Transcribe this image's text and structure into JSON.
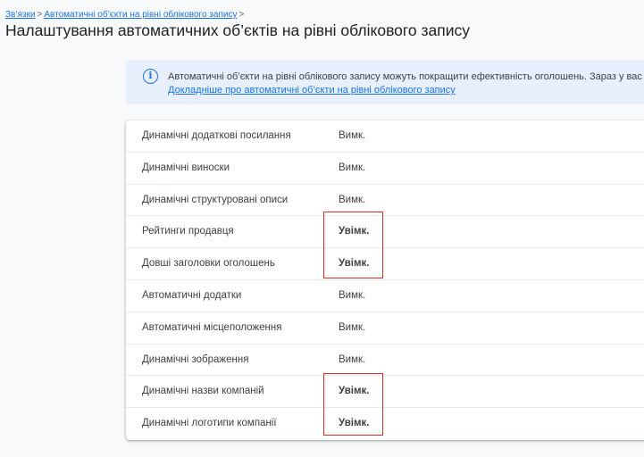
{
  "breadcrumb": {
    "items": [
      "Зв’язки",
      "Автоматичні об’єкти на рівні облікового запису"
    ],
    "separator": ">"
  },
  "page_title": "Налаштування автоматичних об’єктів на рівні облікового запису",
  "info_banner": {
    "icon": "info-icon",
    "text": "Автоматичні об’єкти на рівні облікового запису можуть покращити ефективність оголошень. Зараз у вас",
    "link": "Докладніше про автоматичні об’єкти на рівні облікового запису"
  },
  "settings": [
    {
      "label": "Динамічні додаткові посилання",
      "status": "Вимк."
    },
    {
      "label": "Динамічні виноски",
      "status": "Вимк."
    },
    {
      "label": "Динамічні структуровані описи",
      "status": "Вимк."
    },
    {
      "label": "Рейтинги продавця",
      "status": "Увімк."
    },
    {
      "label": "Довші заголовки оголошень",
      "status": "Увімк."
    },
    {
      "label": "Автоматичні додатки",
      "status": "Вимк."
    },
    {
      "label": "Автоматичні місцеположення",
      "status": "Вимк."
    },
    {
      "label": "Динамічні зображення",
      "status": "Вимк."
    },
    {
      "label": "Динамічні назви компаній",
      "status": "Увімк."
    },
    {
      "label": "Динамічні логотипи компанії",
      "status": "Увімк."
    }
  ],
  "colors": {
    "accent": "#1a73e8",
    "banner_bg": "#e8f0fe",
    "highlight": "#d93025"
  }
}
